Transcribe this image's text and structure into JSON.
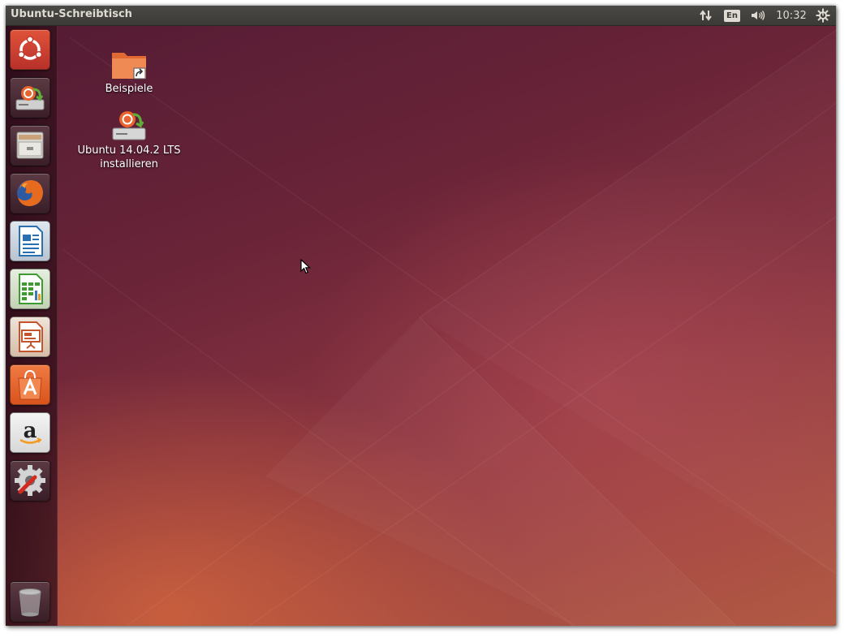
{
  "panel": {
    "title": "Ubuntu-Schreibtisch",
    "keyboard_layout": "En",
    "clock": "10:32"
  },
  "launcher": {
    "items": [
      {
        "name": "dash-home",
        "icon": "ubuntu-logo-icon"
      },
      {
        "name": "install-ubuntu",
        "icon": "installer-icon"
      },
      {
        "name": "files",
        "icon": "file-cabinet-icon"
      },
      {
        "name": "firefox",
        "icon": "firefox-icon"
      },
      {
        "name": "libreoffice-writer",
        "icon": "writer-icon"
      },
      {
        "name": "libreoffice-calc",
        "icon": "calc-icon"
      },
      {
        "name": "libreoffice-impress",
        "icon": "impress-icon"
      },
      {
        "name": "ubuntu-software-center",
        "icon": "shopping-bag-icon"
      },
      {
        "name": "amazon",
        "icon": "amazon-icon"
      },
      {
        "name": "system-settings",
        "icon": "settings-icon"
      },
      {
        "name": "trash",
        "icon": "trash-icon"
      }
    ]
  },
  "desktop": {
    "icons": [
      {
        "label_lines": [
          "Beispiele"
        ],
        "icon": "folder-link-icon"
      },
      {
        "label_lines": [
          "Ubuntu 14.04.2 LTS",
          "installieren"
        ],
        "icon": "installer-icon"
      }
    ]
  },
  "colors": {
    "panel": "#3b3a36",
    "ubuntu_orange": "#dd4814",
    "wallpaper_aubergine": "#5e2750"
  }
}
